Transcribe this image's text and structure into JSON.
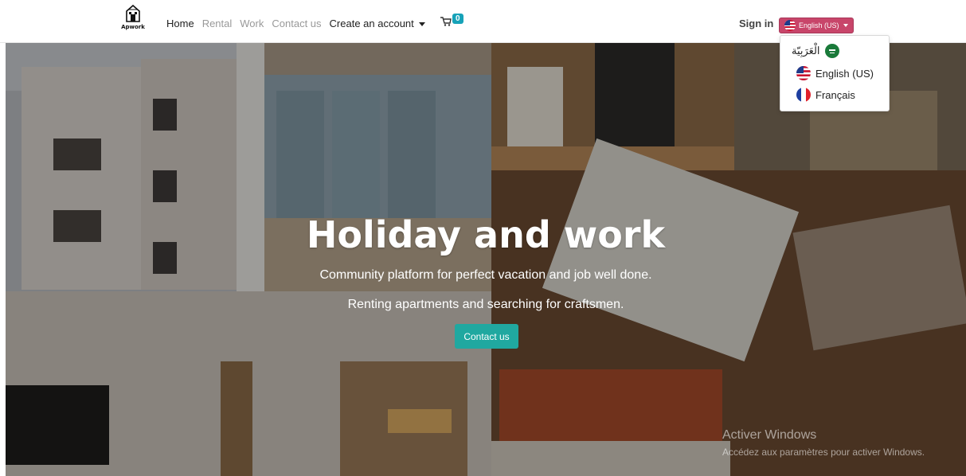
{
  "brand": {
    "logo_text": "Apwork"
  },
  "nav": {
    "home": "Home",
    "rental": "Rental",
    "work": "Work",
    "contact": "Contact us",
    "create_account": "Create an account"
  },
  "cart": {
    "count": "0"
  },
  "signin": "Sign in",
  "language": {
    "current": "English (US)",
    "options": [
      {
        "label": "الْعَرَبِيّة",
        "flag": "saudi-flag-icon"
      },
      {
        "label": "English (US)",
        "flag": "us-flag-icon"
      },
      {
        "label": "Français",
        "flag": "france-flag-icon"
      }
    ]
  },
  "hero": {
    "title": "Holiday and work",
    "subtitle1": "Community platform for perfect vacation and job well done.",
    "subtitle2": "Renting apartments and searching for craftsmen.",
    "cta": "Contact us"
  },
  "watermark": {
    "line1": "Activer Windows",
    "line2": "Accédez aux paramètres pour activer Windows."
  },
  "colors": {
    "accent": "#20a8a0",
    "lang_button": "#c8456a",
    "badge": "#17a2b8"
  }
}
